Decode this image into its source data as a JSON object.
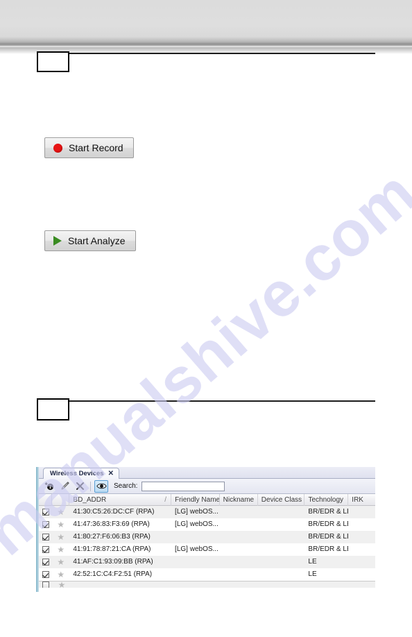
{
  "page": {
    "background_color": "#ffffff",
    "header_band_color": "#dcdcdc",
    "watermark_text": "manualshive.com",
    "watermark_color": "#ccccf2"
  },
  "sections": [
    {
      "box_label": "",
      "rule": true
    },
    {
      "box_label": "",
      "rule": true
    }
  ],
  "buttons": {
    "start_record": {
      "label": "Start Record",
      "icon": "record-dot-icon",
      "icon_color": "#e81414"
    },
    "start_analyze": {
      "label": "Start Analyze",
      "icon": "play-triangle-icon",
      "icon_color": "#3a8c22"
    }
  },
  "devices_panel": {
    "tab": {
      "label": "Wireless Devices",
      "close_glyph": "✕"
    },
    "toolbar": {
      "icons": [
        {
          "name": "add-device-icon",
          "glyph": "ℹ",
          "selected": false
        },
        {
          "name": "edit-pencil-icon",
          "glyph": "✎",
          "selected": false
        },
        {
          "name": "delete-x-icon",
          "glyph": "✕",
          "selected": false
        },
        {
          "name": "eye-visibility-icon",
          "glyph": "◉",
          "selected": true
        }
      ],
      "search_label": "Search:",
      "search_value": "",
      "search_placeholder": ""
    },
    "columns": [
      {
        "key": "check",
        "label": ""
      },
      {
        "key": "star",
        "label": ""
      },
      {
        "key": "bd_addr",
        "label": "BD_ADDR",
        "sorted": true,
        "sort_glyph": "/"
      },
      {
        "key": "friendly_name",
        "label": "Friendly Name"
      },
      {
        "key": "nickname",
        "label": "Nickname"
      },
      {
        "key": "device_class",
        "label": "Device Class"
      },
      {
        "key": "technology",
        "label": "Technology"
      },
      {
        "key": "irk",
        "label": "IRK"
      }
    ],
    "rows": [
      {
        "checked": true,
        "starred": false,
        "bd_addr": "41:30:C5:26:DC:CF (RPA)",
        "friendly_name": "[LG] webOS...",
        "nickname": "",
        "device_class": "",
        "technology": "BR/EDR & LE",
        "irk": ""
      },
      {
        "checked": true,
        "starred": false,
        "bd_addr": "41:47:36:83:F3:69 (RPA)",
        "friendly_name": "[LG] webOS...",
        "nickname": "",
        "device_class": "",
        "technology": "BR/EDR & LE",
        "irk": ""
      },
      {
        "checked": true,
        "starred": false,
        "bd_addr": "41:80:27:F6:06:B3 (RPA)",
        "friendly_name": "",
        "nickname": "",
        "device_class": "",
        "technology": "BR/EDR & LE",
        "irk": ""
      },
      {
        "checked": true,
        "starred": false,
        "bd_addr": "41:91:78:87:21:CA (RPA)",
        "friendly_name": "[LG] webOS...",
        "nickname": "",
        "device_class": "",
        "technology": "BR/EDR & LE",
        "irk": ""
      },
      {
        "checked": true,
        "starred": false,
        "bd_addr": "41:AF:C1:93:09:BB (RPA)",
        "friendly_name": "",
        "nickname": "",
        "device_class": "",
        "technology": "LE",
        "irk": ""
      },
      {
        "checked": true,
        "starred": false,
        "bd_addr": "42:52:1C:C4:F2:51 (RPA)",
        "friendly_name": "",
        "nickname": "",
        "device_class": "",
        "technology": "LE",
        "irk": ""
      }
    ]
  }
}
